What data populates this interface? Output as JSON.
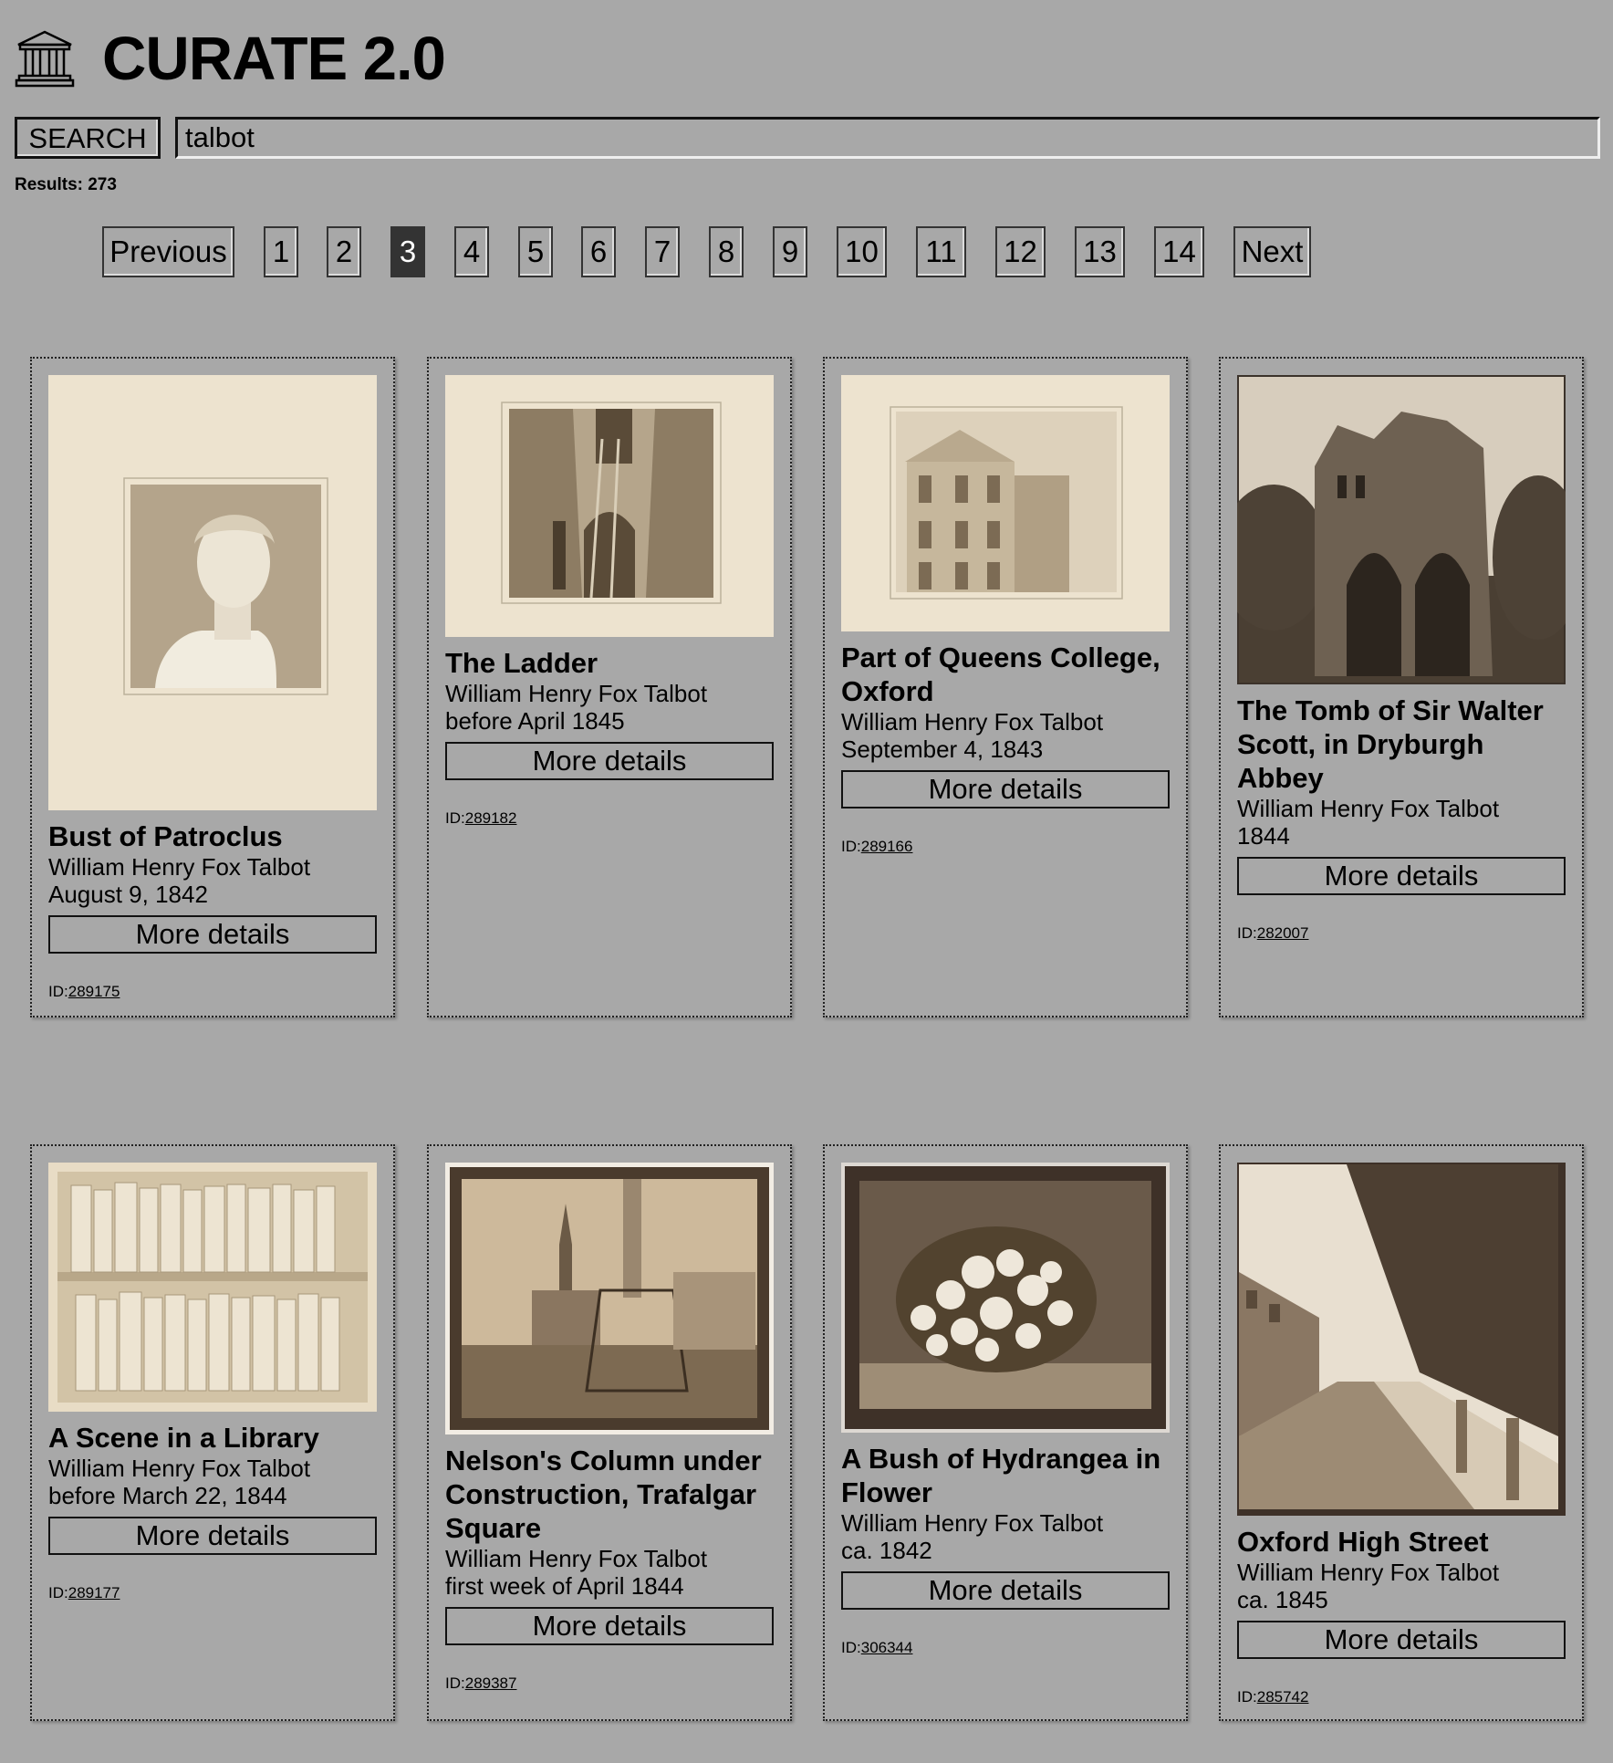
{
  "app": {
    "title": "CURATE 2.0",
    "logo": "museum-icon"
  },
  "search": {
    "button_label": "SEARCH",
    "value": "talbot"
  },
  "results": {
    "label": "Results: 273"
  },
  "pagination": {
    "previous": "Previous",
    "next": "Next",
    "pages": [
      "1",
      "2",
      "3",
      "4",
      "5",
      "6",
      "7",
      "8",
      "9",
      "10",
      "11",
      "12",
      "13",
      "14"
    ],
    "current": "3"
  },
  "cards": [
    {
      "title": "Bust of Patroclus",
      "artist": "William Henry Fox Talbot",
      "date": "August 9, 1842",
      "button": "More details",
      "id_label": "ID:",
      "id": "289175",
      "image": "photo-bust-of-patroclus"
    },
    {
      "title": "The Ladder",
      "artist": "William Henry Fox Talbot",
      "date": "before April 1845",
      "button": "More details",
      "id_label": "ID:",
      "id": "289182",
      "image": "photo-the-ladder"
    },
    {
      "title": "Part of Queens College, Oxford",
      "artist": "William Henry Fox Talbot",
      "date": "September 4, 1843",
      "button": "More details",
      "id_label": "ID:",
      "id": "289166",
      "image": "photo-queens-college"
    },
    {
      "title": "The Tomb of Sir Walter Scott, in Dryburgh Abbey",
      "artist": "William Henry Fox Talbot",
      "date": "1844",
      "button": "More details",
      "id_label": "ID:",
      "id": "282007",
      "image": "photo-dryburgh-abbey"
    },
    {
      "title": "A Scene in a Library",
      "artist": "William Henry Fox Talbot",
      "date": "before March 22, 1844",
      "button": "More details",
      "id_label": "ID:",
      "id": "289177",
      "image": "photo-library-shelves"
    },
    {
      "title": "Nelson's Column under Construction, Trafalgar Square",
      "artist": "William Henry Fox Talbot",
      "date": "first week of April 1844",
      "button": "More details",
      "id_label": "ID:",
      "id": "289387",
      "image": "photo-nelsons-column"
    },
    {
      "title": "A Bush of Hydrangea in Flower",
      "artist": "William Henry Fox Talbot",
      "date": "ca. 1842",
      "button": "More details",
      "id_label": "ID:",
      "id": "306344",
      "image": "photo-hydrangea"
    },
    {
      "title": "Oxford High Street",
      "artist": "William Henry Fox Talbot",
      "date": "ca. 1845",
      "button": "More details",
      "id_label": "ID:",
      "id": "285742",
      "image": "photo-oxford-high-street"
    }
  ]
}
